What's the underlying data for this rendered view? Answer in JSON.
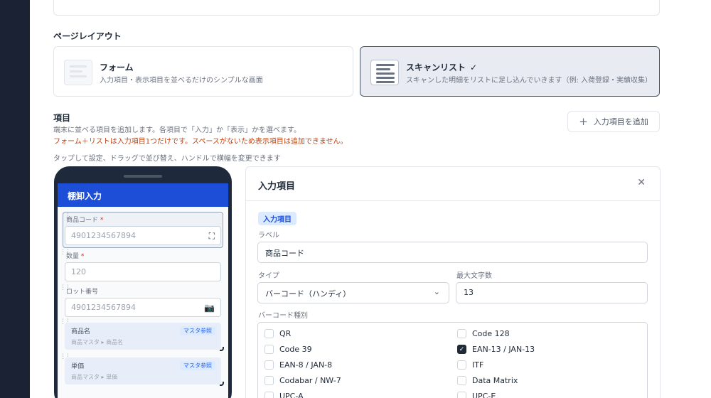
{
  "page_layout": {
    "section_title": "ページレイアウト",
    "options": [
      {
        "name": "フォーム",
        "desc": "入力項目・表示項目を並べるだけのシンプルな画面",
        "selected": false
      },
      {
        "name": "スキャンリスト",
        "desc": "スキャンした明細をリストに足し込んでいきます（例: 入荷登録・実績収集）",
        "selected": true,
        "check": "✓"
      }
    ]
  },
  "items": {
    "title": "項目",
    "desc": "端末に並べる項目を追加します。各項目で「入力」か「表示」かを選べます。",
    "warning": "フォーム＋リストは入力項目1つだけです。スペースがないため表示項目は追加できません。",
    "hint": "タップして設定、ドラッグで並び替え、ハンドルで横幅を変更できます",
    "add_button": "入力項目を追加",
    "add_icon": "plus-icon"
  },
  "phone": {
    "title": "棚卸入力",
    "fields": [
      {
        "label": "商品コード",
        "required": "*",
        "value": "4901234567894",
        "icon": "scan-icon"
      },
      {
        "label": "数量",
        "required": "*",
        "value": "120"
      },
      {
        "label": "ロット番号",
        "value": "4901234567894",
        "icon": "camera-icon"
      }
    ],
    "display_fields": [
      {
        "label": "商品名",
        "badge": "マスタ参照",
        "source": "商品マスタ ▸ 商品名"
      },
      {
        "label": "単価",
        "badge": "マスタ参照",
        "source": "商品マスタ ▸ 単価"
      }
    ]
  },
  "panel": {
    "title": "入力項目",
    "badge": "入力項目",
    "label_label": "ラベル",
    "label_value": "商品コード",
    "type_label": "タイプ",
    "type_value": "バーコード（ハンディ）",
    "maxlen_label": "最大文字数",
    "maxlen_value": "13",
    "barcode_label": "バーコード種別",
    "barcodes": [
      {
        "name": "QR",
        "checked": false
      },
      {
        "name": "Code 128",
        "checked": false
      },
      {
        "name": "Code 39",
        "checked": false
      },
      {
        "name": "EAN-13 / JAN-13",
        "checked": true
      },
      {
        "name": "EAN-8 / JAN-8",
        "checked": false
      },
      {
        "name": "ITF",
        "checked": false
      },
      {
        "name": "Codabar / NW-7",
        "checked": false
      },
      {
        "name": "Data Matrix",
        "checked": false
      },
      {
        "name": "UPC-A",
        "checked": false
      },
      {
        "name": "UPC-E",
        "checked": false
      }
    ]
  },
  "colors": {
    "accent": "#1d4ed8",
    "sidebar": "#1a2233",
    "warning": "#c2410c"
  }
}
